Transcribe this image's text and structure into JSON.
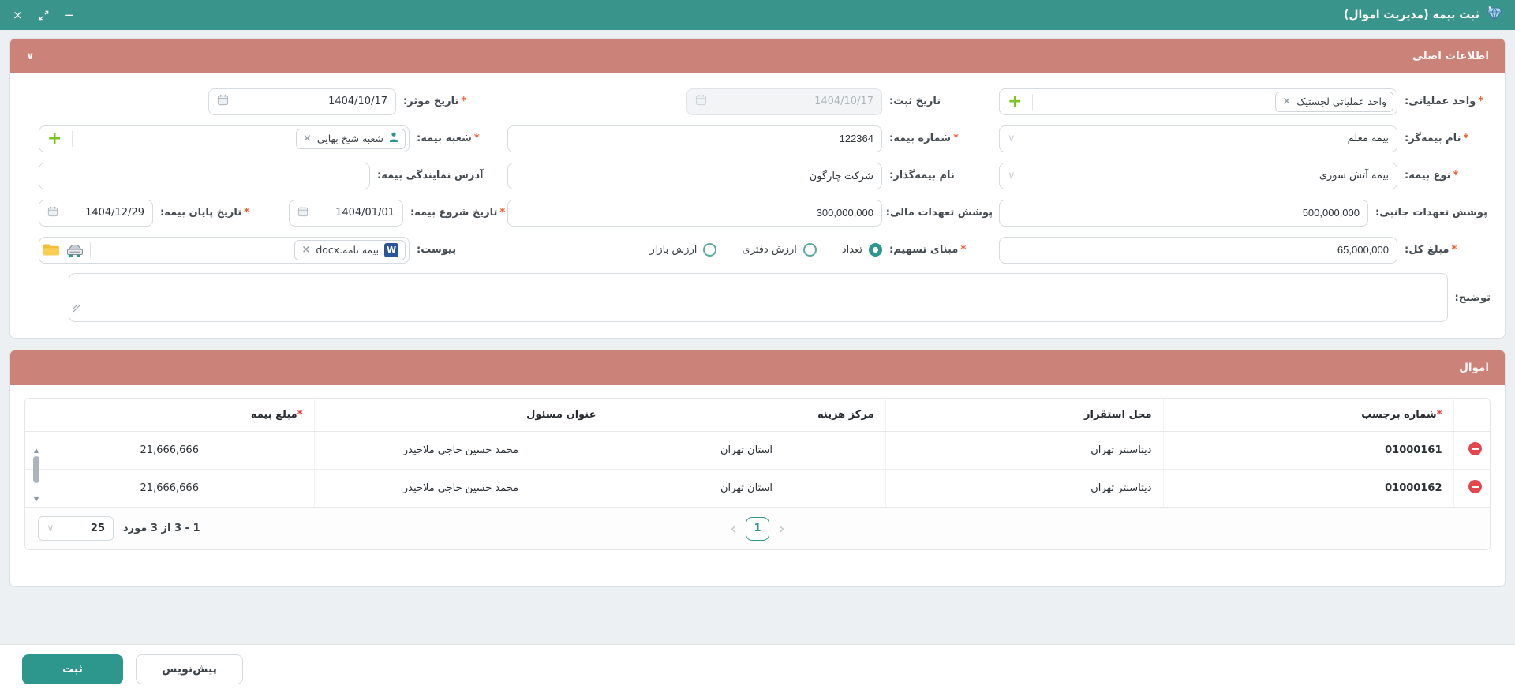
{
  "window": {
    "title": "ثبت بیمه (مدیریت اموال)",
    "controls": {
      "close": "×",
      "minimize": "−"
    }
  },
  "marks": {
    "required": "*",
    "chip_remove": "×",
    "plus": "+",
    "chevron_down": "∨",
    "doc_badge": "W",
    "scroll_up": "▲",
    "scroll_down": "▼"
  },
  "main_section": {
    "title": "اطلاعات اصلی",
    "fields": {
      "operational_unit": {
        "label": "واحد عملیاتی:",
        "required": true,
        "chip": "واحد عملیاتی لجستیک"
      },
      "register_date": {
        "label": "تاریخ ثبت:",
        "value": "1404/10/17",
        "disabled": true
      },
      "effective_date": {
        "label": "تاریخ موثر:",
        "required": true,
        "value": "1404/10/17"
      },
      "insurer_name": {
        "label": "نام بیمه‌گر:",
        "required": true,
        "value": "بیمه معلم"
      },
      "insurance_number": {
        "label": "شماره بیمه:",
        "required": true,
        "value": "122364"
      },
      "insurance_branch": {
        "label": "شعبه بیمه:",
        "required": true,
        "chip": "شعبه شیخ بهایی"
      },
      "insurance_type": {
        "label": "نوع بیمه:",
        "required": true,
        "value": "بیمه آتش سوزی"
      },
      "policyholder_name": {
        "label": "نام بیمه‌گذار:",
        "value": "شرکت چارگون"
      },
      "agency_address": {
        "label": "آدرس نمایندگی بیمه:",
        "value": ""
      },
      "collateral_coverage": {
        "label": "پوشش تعهدات جانبی:",
        "value": "500,000,000"
      },
      "financial_coverage": {
        "label": "پوشش تعهدات مالی:",
        "value": "300,000,000"
      },
      "start_date": {
        "label": "تاریخ شروع بیمه:",
        "required": true,
        "value": "1404/01/01"
      },
      "end_date": {
        "label": "تاریخ پایان بیمه:",
        "required": true,
        "value": "1404/12/29"
      },
      "total_amount": {
        "label": "مبلغ کل:",
        "required": true,
        "value": "65,000,000"
      },
      "allocation_basis": {
        "label": "مبنای تسهیم:",
        "required": true,
        "options": [
          {
            "label": "تعداد",
            "selected": true
          },
          {
            "label": "ارزش دفتری",
            "selected": false
          },
          {
            "label": "ارزش بازار",
            "selected": false
          }
        ]
      },
      "attachment": {
        "label": "پیوست:",
        "file_name": "بیمه نامه.docx"
      },
      "description": {
        "label": "توضیح:",
        "value": ""
      }
    }
  },
  "assets_section": {
    "title": "اموال",
    "table": {
      "columns": [
        {
          "label": "شماره برچسب",
          "required": true
        },
        {
          "label": "محل استقرار",
          "required": false
        },
        {
          "label": "مرکز هزینه",
          "required": false
        },
        {
          "label": "عنوان مسئول",
          "required": false
        },
        {
          "label": "مبلغ بیمه",
          "required": true
        }
      ],
      "rows": [
        {
          "tag_number": "01000161",
          "location": "دیتاسنتر تهران",
          "cost_center": "استان تهران",
          "responsible": "محمد حسین حاجی ملاحیدر",
          "insurance_amount": "21,666,666"
        },
        {
          "tag_number": "01000162",
          "location": "دیتاسنتر تهران",
          "cost_center": "استان تهران",
          "responsible": "محمد حسین حاجی ملاحیدر",
          "insurance_amount": "21,666,666"
        }
      ]
    },
    "pagination": {
      "page_size": "25",
      "range_text": "1 - 3 از 3 مورد",
      "current_page": "1",
      "prev": "‹",
      "next": "›"
    }
  },
  "footer": {
    "submit_label": "ثبت",
    "draft_label": "پیش‌نویس"
  },
  "colors": {
    "accent_teal": "#39948b",
    "section_header_salmon": "#ca8279",
    "required_orange": "#ef5a2a",
    "required_red": "#e03b3b",
    "add_green": "#7cc41f",
    "remove_red": "#e2474e"
  }
}
